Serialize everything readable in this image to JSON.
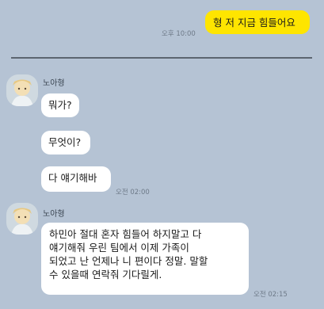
{
  "messages": {
    "outgoing_1": {
      "text": "형 저 지금 힘들어요",
      "time": "오후 10:00"
    },
    "group_1": {
      "sender": "노아형",
      "bubbles": [
        "뭐가?",
        "무엇이?",
        "다 얘기해바"
      ],
      "time": "오전 02:00"
    },
    "group_2": {
      "sender": "노아형",
      "lines": [
        "하민아 절대 혼자 힘들어 하지말고 다",
        "얘기해줘 우린 팀에서 이제 가족이",
        "되었고  난 언제나 니 편이다 정말. 말할",
        "수 있을때 연락줘 기다릴게."
      ],
      "time": "오전 02:15"
    }
  },
  "colors": {
    "background": "#b5c3d4",
    "outgoing_bubble": "#fee500",
    "incoming_bubble": "#ffffff"
  }
}
